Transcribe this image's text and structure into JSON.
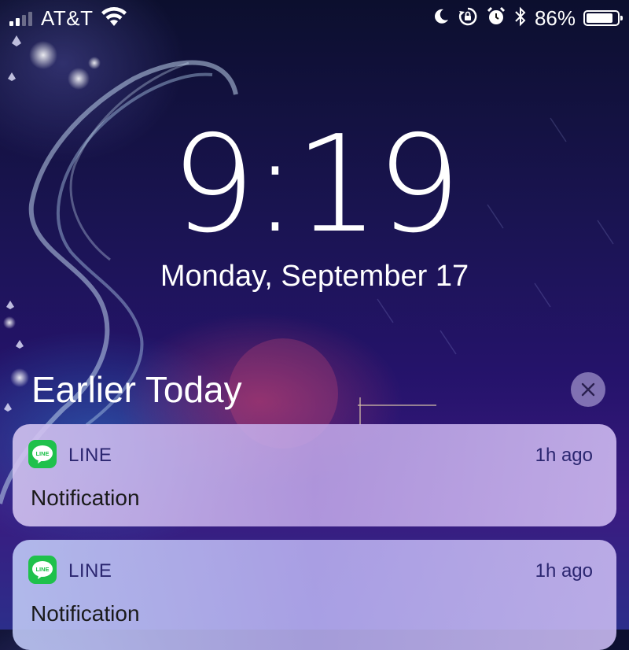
{
  "status_bar": {
    "carrier": "AT&T",
    "signal_bars": 2,
    "battery_percent": "86%",
    "battery_level": 0.86,
    "icons": [
      "do-not-disturb-moon-icon",
      "rotation-lock-icon",
      "alarm-icon",
      "bluetooth-icon"
    ]
  },
  "lock_screen": {
    "time": "9:19",
    "date": "Monday, September 17"
  },
  "notification_center": {
    "section_title": "Earlier Today",
    "notifications": [
      {
        "app": "LINE",
        "icon_text": "LINE",
        "time": "1h ago",
        "message": "Notification"
      },
      {
        "app": "LINE",
        "icon_text": "LINE",
        "time": "1h ago",
        "message": "Notification"
      }
    ]
  },
  "colors": {
    "line_green": "#1fc14b",
    "app_name_text": "#2b2670"
  }
}
